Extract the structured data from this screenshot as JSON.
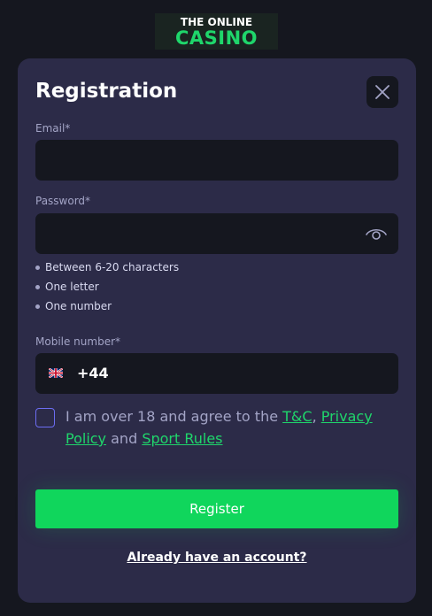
{
  "logo": {
    "line1": "THE ONLINE",
    "line2": "CASINO"
  },
  "modal": {
    "title": "Registration",
    "close_icon": "close-icon"
  },
  "email": {
    "label": "Email*",
    "value": ""
  },
  "password": {
    "label": "Password*",
    "value": "",
    "toggle_icon": "eye-icon",
    "rules": [
      "Between 6-20 characters",
      "One letter",
      "One number"
    ]
  },
  "mobile": {
    "label": "Mobile number*",
    "flag_icon": "uk-flag-icon",
    "country_code": "+44",
    "value": ""
  },
  "agreement": {
    "checked": false,
    "text_1": "I am over 18 and agree to the ",
    "link_tc": "T&C",
    "text_2": ", ",
    "link_privacy": "Privacy Policy",
    "text_3": " and ",
    "link_sport": "Sport Rules"
  },
  "actions": {
    "register_label": "Register",
    "login_link": "Already have an account?"
  },
  "colors": {
    "background": "#15171f",
    "modal": "#2c2b48",
    "input": "#15171f",
    "accent": "#10d65c",
    "link": "#1fd66b",
    "checkbox_border": "#6c6df2"
  }
}
